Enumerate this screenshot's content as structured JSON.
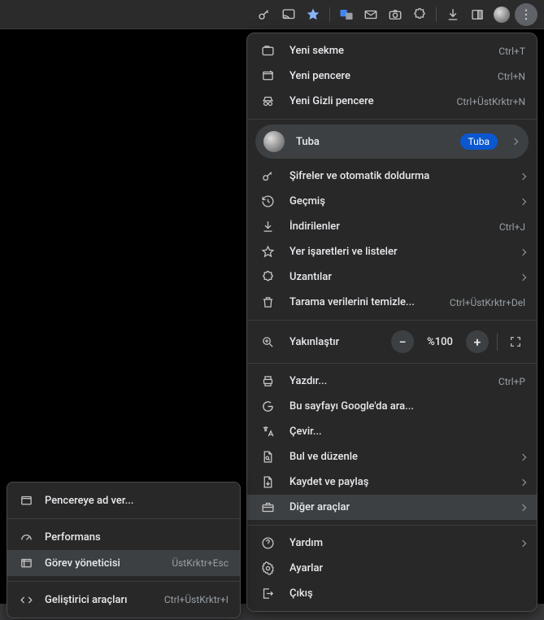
{
  "toolbar_icons": [
    "key-icon",
    "cast-icon",
    "star-icon",
    "translate-icon",
    "mail-icon",
    "camera-icon",
    "puzzle-icon",
    "download-icon",
    "panel-icon",
    "avatar-icon",
    "kebab-icon"
  ],
  "menu": {
    "new_tab": {
      "label": "Yeni sekme",
      "shortcut": "Ctrl+T"
    },
    "new_window": {
      "label": "Yeni pencere",
      "shortcut": "Ctrl+N"
    },
    "incognito": {
      "label": "Yeni Gizli pencere",
      "shortcut": "Ctrl+ÜstKrktr+N"
    },
    "profile": {
      "label": "Tuba",
      "badge": "Tuba"
    },
    "passwords": {
      "label": "Şifreler ve otomatik doldurma"
    },
    "history": {
      "label": "Geçmiş"
    },
    "downloads": {
      "label": "İndirilenler",
      "shortcut": "Ctrl+J"
    },
    "bookmarks": {
      "label": "Yer işaretleri ve listeler"
    },
    "extensions": {
      "label": "Uzantılar"
    },
    "clear_data": {
      "label": "Tarama verilerini temizle...",
      "shortcut": "Ctrl+ÜstKrktr+Del"
    },
    "zoom": {
      "label": "Yakınlaştır",
      "value": "%100"
    },
    "print": {
      "label": "Yazdır...",
      "shortcut": "Ctrl+P"
    },
    "search_google": {
      "label": "Bu sayfayı Google'da ara..."
    },
    "translate": {
      "label": "Çevir..."
    },
    "find_edit": {
      "label": "Bul ve düzenle"
    },
    "save_share": {
      "label": "Kaydet ve paylaş"
    },
    "more_tools": {
      "label": "Diğer araçlar"
    },
    "help": {
      "label": "Yardım"
    },
    "settings": {
      "label": "Ayarlar"
    },
    "exit": {
      "label": "Çıkış"
    }
  },
  "submenu": {
    "name_window": {
      "label": "Pencereye ad ver..."
    },
    "performance": {
      "label": "Performans"
    },
    "task_manager": {
      "label": "Görev yöneticisi",
      "shortcut": "ÜstKrktr+Esc"
    },
    "dev_tools": {
      "label": "Geliştirici araçları",
      "shortcut": "Ctrl+ÜstKrktr+I"
    }
  }
}
